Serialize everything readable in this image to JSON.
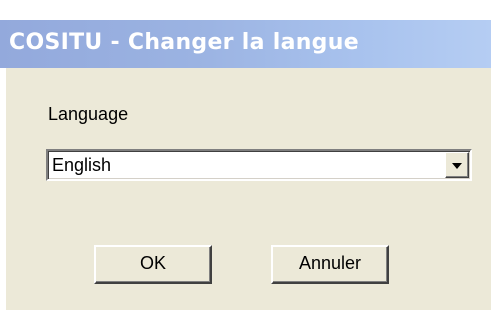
{
  "window": {
    "title": "COSITU - Changer la langue"
  },
  "form": {
    "language_label": "Language",
    "language_select": {
      "selected": "English"
    }
  },
  "buttons": {
    "ok_label": "OK",
    "cancel_label": "Annuler"
  },
  "icons": {
    "dropdown": "chevron-down-icon"
  },
  "colors": {
    "titlebar_start": "#93a9dc",
    "titlebar_end": "#b5cdf3",
    "dialog_face": "#ece9d8"
  }
}
